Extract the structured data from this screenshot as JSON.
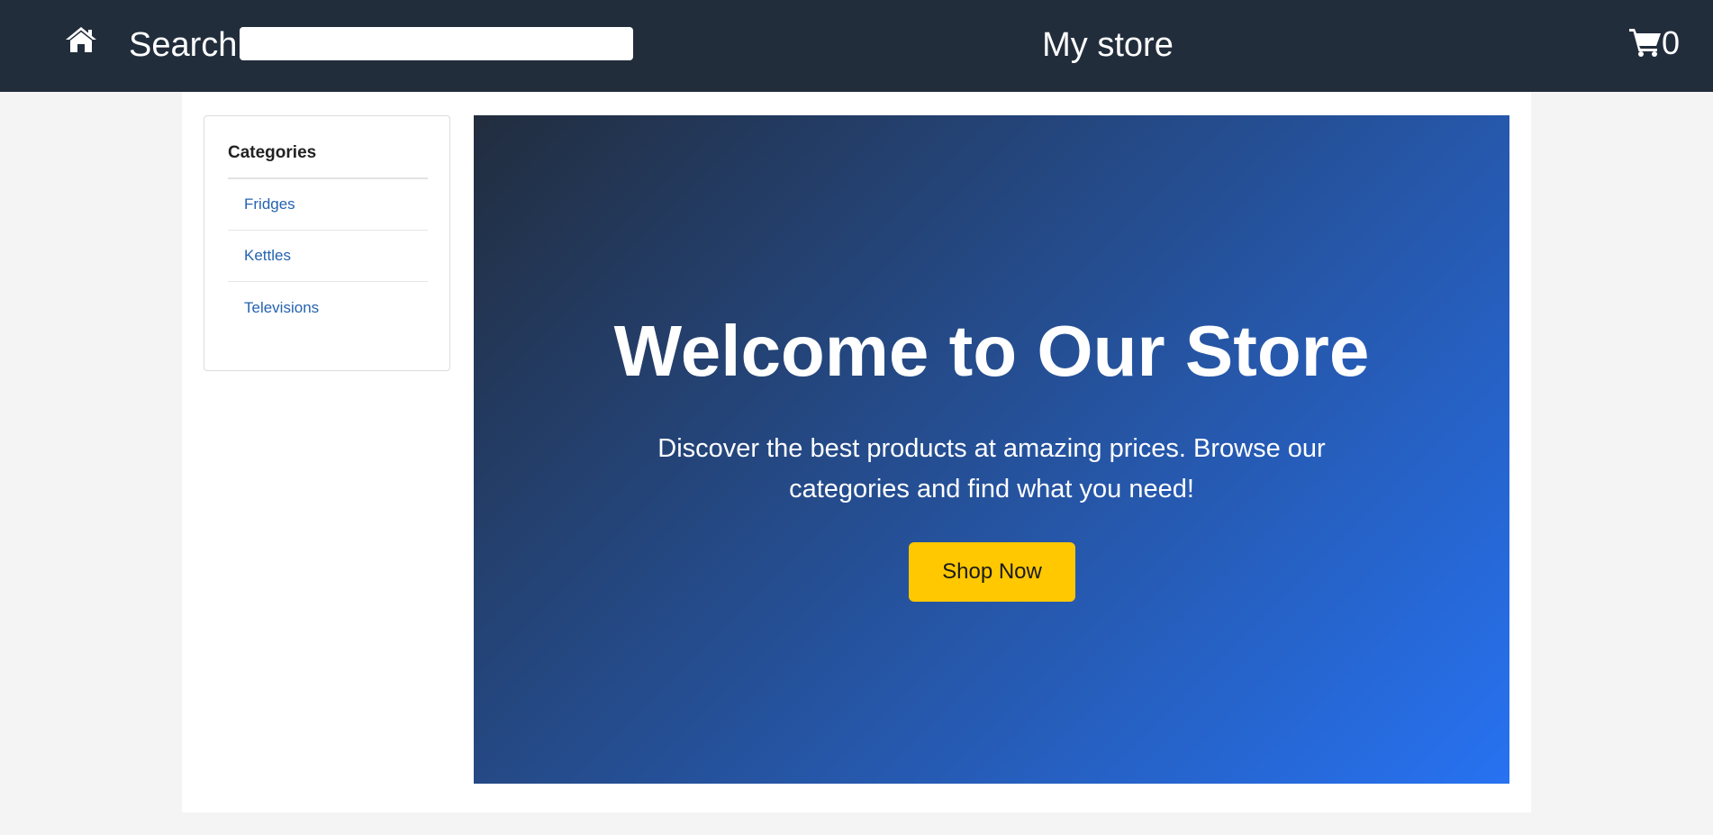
{
  "header": {
    "home_icon": "home-icon",
    "search_label": "Search",
    "search_value": "",
    "search_placeholder": "",
    "store_title": "My store",
    "cart_icon": "shopping-cart-icon",
    "cart_count": "0"
  },
  "sidebar": {
    "title": "Categories",
    "items": [
      {
        "label": "Fridges"
      },
      {
        "label": "Kettles"
      },
      {
        "label": "Televisions"
      }
    ]
  },
  "hero": {
    "title": "Welcome to Our Store",
    "subtitle": "Discover the best products at amazing prices. Browse our categories and find what you need!",
    "button_label": "Shop Now"
  },
  "colors": {
    "header_bg": "#222d3c",
    "link": "#2563b0",
    "button_bg": "#ffc800",
    "hero_gradient_start": "#222d3e",
    "hero_gradient_end": "#2772f2"
  }
}
